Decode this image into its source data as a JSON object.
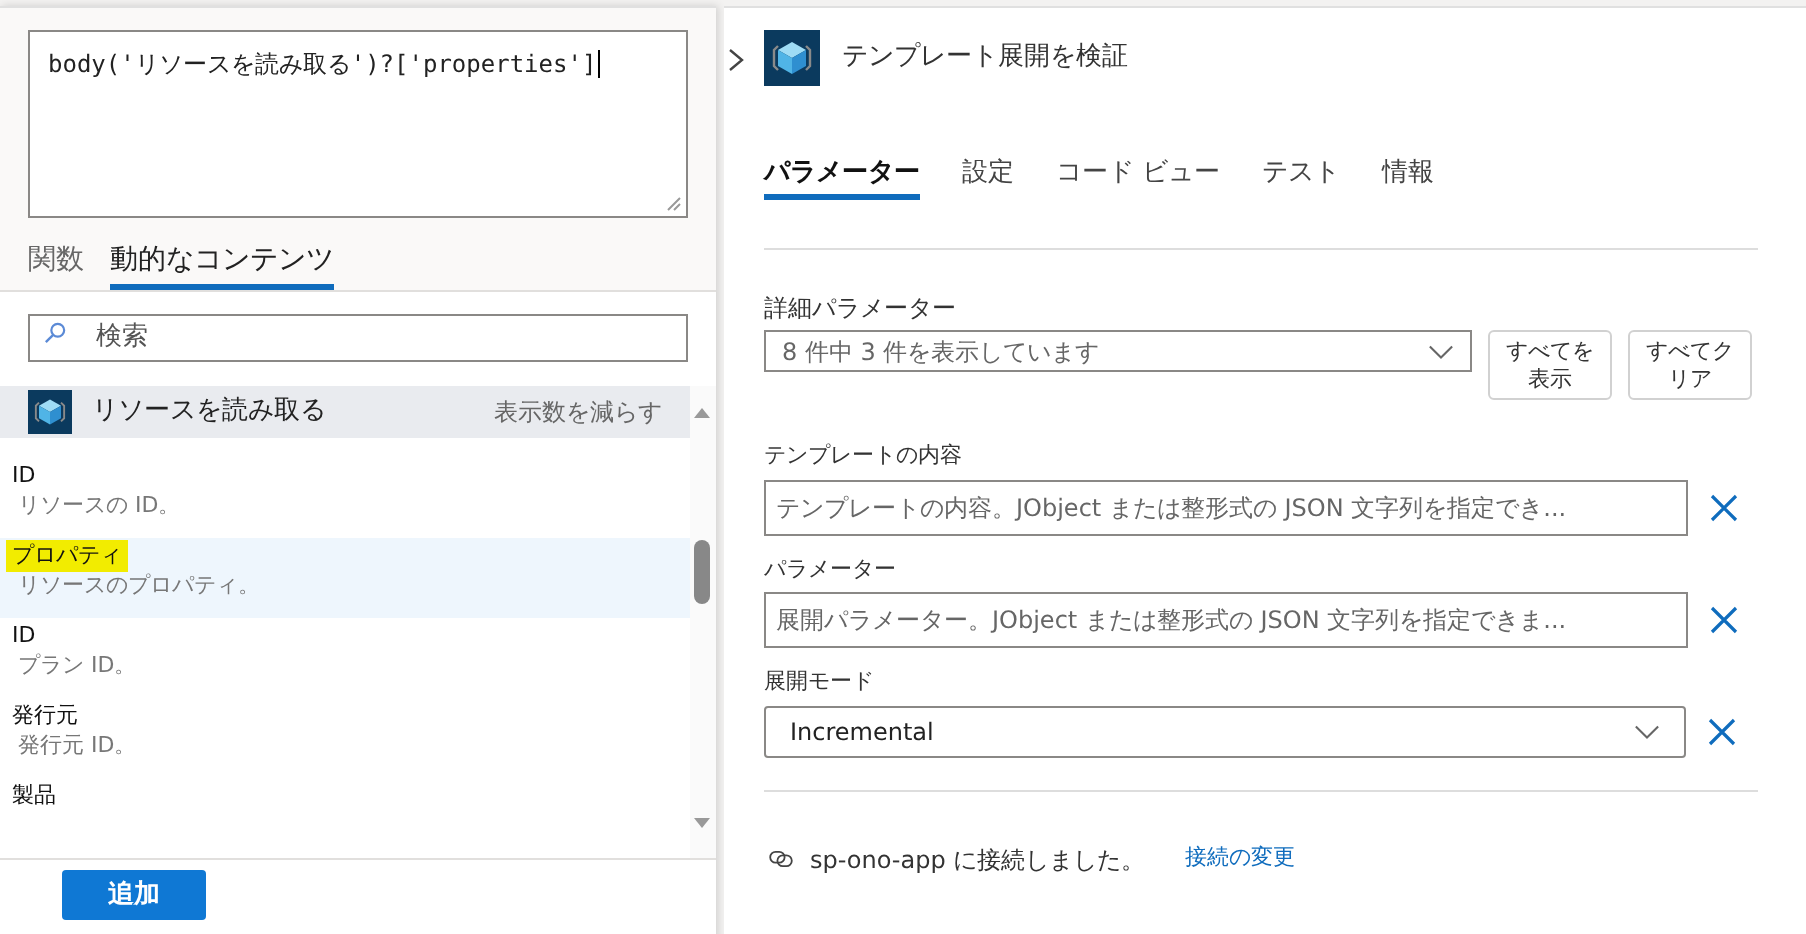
{
  "expression_editor": {
    "value": "body('リソースを読み取る')?['properties']"
  },
  "editor_tabs": [
    {
      "label": "関数",
      "selected": false
    },
    {
      "label": "動的なコンテンツ",
      "selected": true
    }
  ],
  "search": {
    "placeholder": "検索"
  },
  "content_group": {
    "title": "リソースを読み取る",
    "toggle": "表示数を減らす",
    "items": [
      {
        "name": "ID",
        "description": "リソースの ID。",
        "selected": false,
        "highlighted": false
      },
      {
        "name": "プロパティ",
        "description": "リソースのプロパティ。",
        "selected": true,
        "highlighted": true
      },
      {
        "name": "ID",
        "description": "プラン ID。",
        "selected": false,
        "highlighted": false
      },
      {
        "name": "発行元",
        "description": "発行元 ID。",
        "selected": false,
        "highlighted": false
      },
      {
        "name": "製品",
        "selected": false,
        "highlighted": false
      }
    ]
  },
  "add_button": "追加",
  "action": {
    "title": "テンプレート展開を検証",
    "tabs": [
      {
        "label": "パラメーター",
        "selected": true
      },
      {
        "label": "設定",
        "selected": false
      },
      {
        "label": "コード ビュー",
        "selected": false
      },
      {
        "label": "テスト",
        "selected": false
      },
      {
        "label": "情報",
        "selected": false
      }
    ],
    "advanced": {
      "label": "詳細パラメーター",
      "value": "8 件中 3 件を表示しています",
      "buttons": [
        "すべてを表示",
        "すべてクリア"
      ]
    },
    "fields": [
      {
        "kind": "text",
        "label": "テンプレートの内容",
        "placeholder": "テンプレートの内容。JObject または整形式の JSON 文字列を指定でき..."
      },
      {
        "kind": "text",
        "label": "パラメーター",
        "placeholder": "展開パラメーター。JObject または整形式の JSON 文字列を指定できま..."
      },
      {
        "kind": "select",
        "label": "展開モード",
        "value": "Incremental"
      }
    ],
    "connection": {
      "text": "sp-ono-app に接続しました。",
      "link": "接続の変更"
    }
  }
}
